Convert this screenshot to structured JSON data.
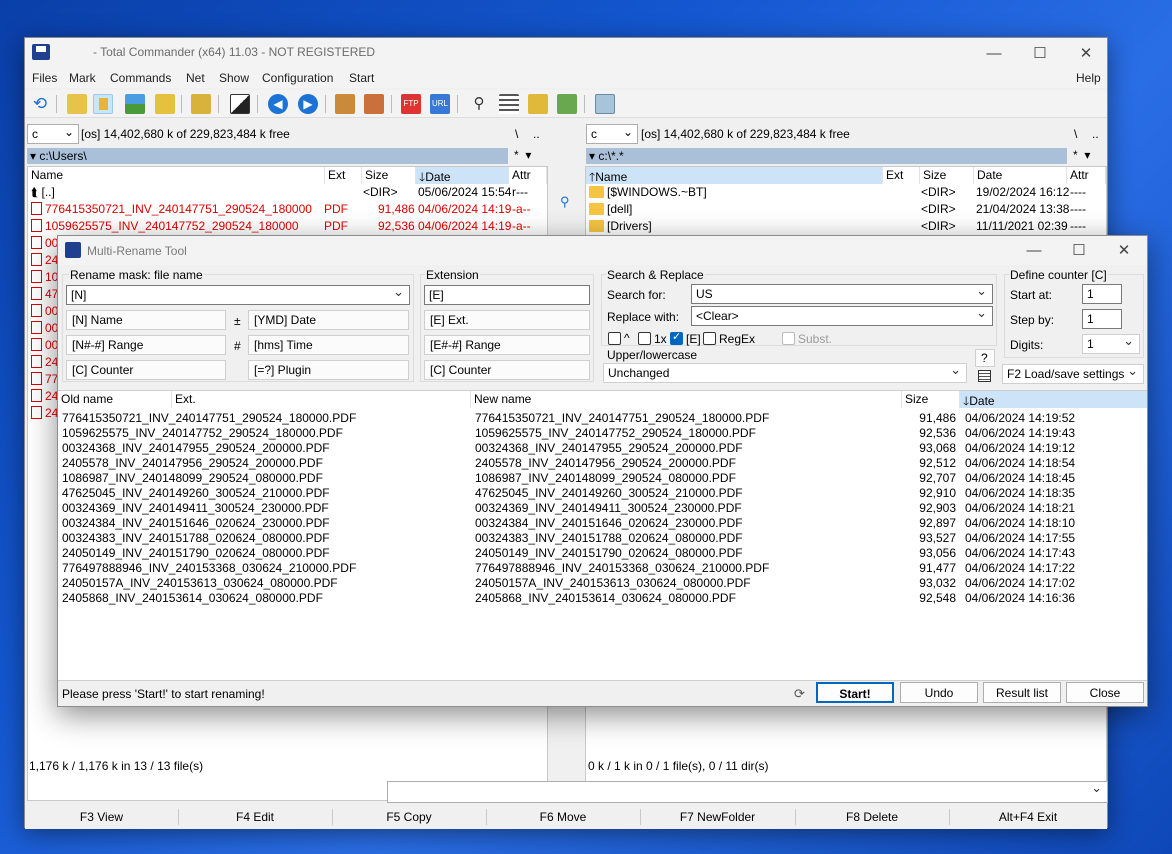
{
  "window": {
    "title": "- Total Commander (x64) 11.03 - NOT REGISTERED",
    "min": "—",
    "max": "☐",
    "close": "✕"
  },
  "menu": [
    "Files",
    "Mark",
    "Commands",
    "Net",
    "Show",
    "Configuration",
    "Start"
  ],
  "menu_help": "Help",
  "left": {
    "drive": "c",
    "drive_info": "[os]  14,402,680 k of 229,823,484 k free",
    "root": "\\",
    "up": "..",
    "path": "c:\\Users\\",
    "filter": "*",
    "cols": {
      "name": "Name",
      "ext": "Ext",
      "size": "Size",
      "date": "Date",
      "attr": "Attr"
    },
    "rows": [
      {
        "name": "[..]",
        "ext": "",
        "size": "<DIR>",
        "date": "05/06/2024 15:54",
        "attr": "r---"
      },
      {
        "name": "776415350721_INV_240147751_290524_180000",
        "ext": "PDF",
        "size": "91,486",
        "date": "04/06/2024 14:19",
        "attr": "-a--"
      },
      {
        "name": "1059625575_INV_240147752_290524_180000",
        "ext": "PDF",
        "size": "92,536",
        "date": "04/06/2024 14:19",
        "attr": "-a--"
      }
    ],
    "stub_names": [
      "00",
      "24",
      "10",
      "47",
      "00",
      "00",
      "00",
      "24",
      "77",
      "24",
      "24"
    ],
    "status": "1,176 k / 1,176 k in 13 / 13 file(s)"
  },
  "right": {
    "drive": "c",
    "drive_info": "[os]  14,402,680 k of 229,823,484 k free",
    "root": "\\",
    "up": "..",
    "path": "c:\\*.*",
    "filter": "*",
    "cols": {
      "name": "Name",
      "ext": "Ext",
      "size": "Size",
      "date": "Date",
      "attr": "Attr"
    },
    "rows": [
      {
        "name": "[$WINDOWS.~BT]",
        "size": "<DIR>",
        "date": "19/02/2024 16:12",
        "attr": "----"
      },
      {
        "name": "[dell]",
        "size": "<DIR>",
        "date": "21/04/2024 13:38",
        "attr": "----"
      },
      {
        "name": "[Drivers]",
        "size": "<DIR>",
        "date": "11/11/2021 02:39",
        "attr": "----"
      }
    ],
    "status": "0 k / 1 k in 0 / 1 file(s), 0 / 11 dir(s)"
  },
  "fkeys": [
    "F3 View",
    "F4 Edit",
    "F5 Copy",
    "F6 Move",
    "F7 NewFolder",
    "F8 Delete",
    "Alt+F4 Exit"
  ],
  "dialog": {
    "title": "Multi-Rename Tool",
    "mask_label": "Rename mask: file name",
    "mask_value": "[N]",
    "mask_buttons": [
      "[N]  Name",
      "[N#-#] Range",
      "[C]  Counter"
    ],
    "mask_buttons2": [
      "[YMD]  Date",
      "[hms]  Time",
      "[=?]  Plugin"
    ],
    "sym_plus": "±",
    "sym_hash": "#",
    "ext_label": "Extension",
    "ext_value": "[E]",
    "ext_buttons": [
      "[E]  Ext.",
      "[E#-#] Range",
      "[C]  Counter"
    ],
    "sr_label": "Search & Replace",
    "search_label": "Search for:",
    "search_value": "US",
    "replace_label": "Replace with:",
    "replace_value": "<Clear>",
    "opt_caret": "^",
    "opt_1x": "1x",
    "opt_e": "[E]",
    "opt_regex": "RegEx",
    "opt_subst": "Subst.",
    "case_label": "Upper/lowercase",
    "case_value": "Unchanged",
    "help": "?",
    "counter_label": "Define counter [C]",
    "start_at_label": "Start at:",
    "start_at": "1",
    "step_label": "Step by:",
    "step": "1",
    "digits_label": "Digits:",
    "digits": "1",
    "loadsave": "F2 Load/save settings",
    "cols": {
      "old": "Old name",
      "ext": "Ext.",
      "new": "New name",
      "size": "Size",
      "date": "Date"
    },
    "files": [
      {
        "old": "776415350721_INV_240147751_290524_180000.PDF",
        "new": "776415350721_INV_240147751_290524_180000.PDF",
        "size": "91,486",
        "date": "04/06/2024 14:19:52"
      },
      {
        "old": "1059625575_INV_240147752_290524_180000.PDF",
        "new": "1059625575_INV_240147752_290524_180000.PDF",
        "size": "92,536",
        "date": "04/06/2024 14:19:43"
      },
      {
        "old": "00324368_INV_240147955_290524_200000.PDF",
        "new": "00324368_INV_240147955_290524_200000.PDF",
        "size": "93,068",
        "date": "04/06/2024 14:19:12"
      },
      {
        "old": "2405578_INV_240147956_290524_200000.PDF",
        "new": "2405578_INV_240147956_290524_200000.PDF",
        "size": "92,512",
        "date": "04/06/2024 14:18:54"
      },
      {
        "old": "1086987_INV_240148099_290524_080000.PDF",
        "new": "1086987_INV_240148099_290524_080000.PDF",
        "size": "92,707",
        "date": "04/06/2024 14:18:45"
      },
      {
        "old": "47625045_INV_240149260_300524_210000.PDF",
        "new": "47625045_INV_240149260_300524_210000.PDF",
        "size": "92,910",
        "date": "04/06/2024 14:18:35"
      },
      {
        "old": "00324369_INV_240149411_300524_230000.PDF",
        "new": "00324369_INV_240149411_300524_230000.PDF",
        "size": "92,903",
        "date": "04/06/2024 14:18:21"
      },
      {
        "old": "00324384_INV_240151646_020624_230000.PDF",
        "new": "00324384_INV_240151646_020624_230000.PDF",
        "size": "92,897",
        "date": "04/06/2024 14:18:10"
      },
      {
        "old": "00324383_INV_240151788_020624_080000.PDF",
        "new": "00324383_INV_240151788_020624_080000.PDF",
        "size": "93,527",
        "date": "04/06/2024 14:17:55"
      },
      {
        "old": "24050149_INV_240151790_020624_080000.PDF",
        "new": "24050149_INV_240151790_020624_080000.PDF",
        "size": "93,056",
        "date": "04/06/2024 14:17:43"
      },
      {
        "old": "776497888946_INV_240153368_030624_210000.PDF",
        "new": "776497888946_INV_240153368_030624_210000.PDF",
        "size": "91,477",
        "date": "04/06/2024 14:17:22"
      },
      {
        "old": "24050157A_INV_240153613_030624_080000.PDF",
        "new": "24050157A_INV_240153613_030624_080000.PDF",
        "size": "93,032",
        "date": "04/06/2024 14:17:02"
      },
      {
        "old": "2405868_INV_240153614_030624_080000.PDF",
        "new": "2405868_INV_240153614_030624_080000.PDF",
        "size": "92,548",
        "date": "04/06/2024 14:16:36"
      }
    ],
    "status": "Please press 'Start!' to start renaming!",
    "btn_start": "Start!",
    "btn_undo": "Undo",
    "btn_result": "Result list",
    "btn_close": "Close"
  }
}
